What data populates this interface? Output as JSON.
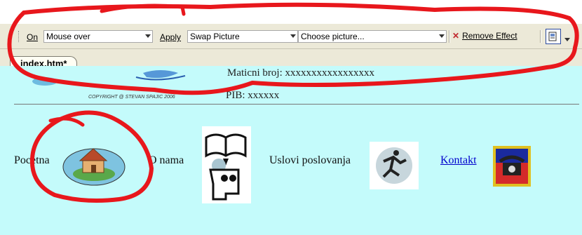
{
  "toolbar": {
    "on_label": "On",
    "event_value": "Mouse over",
    "apply_label": "Apply",
    "effect_value": "Swap Picture",
    "picture_value": "Choose picture...",
    "remove_label": "Remove Effect"
  },
  "tab": {
    "label": "index.htm*"
  },
  "page": {
    "copyright": "COPYRIGHT @ STEVAN SPAJIC 2006",
    "maticni": "Maticni broj: xxxxxxxxxxxxxxxxx",
    "pib": "PIB: xxxxxx",
    "nav": [
      "Pocetna",
      "O nama",
      "Uslovi poslovanja",
      "Kontakt"
    ]
  },
  "icons": [
    "dropdown-arrow-icon",
    "remove-effect-icon",
    "view-button-icon",
    "logo-image",
    "house-icon",
    "book-head-icon",
    "runner-icon",
    "telephone-icon"
  ],
  "colors": {
    "annotation": "#e8171c",
    "page_bg": "#c4fbfb",
    "toolbar_bg": "#ece9d8",
    "link": "#0000cc"
  }
}
